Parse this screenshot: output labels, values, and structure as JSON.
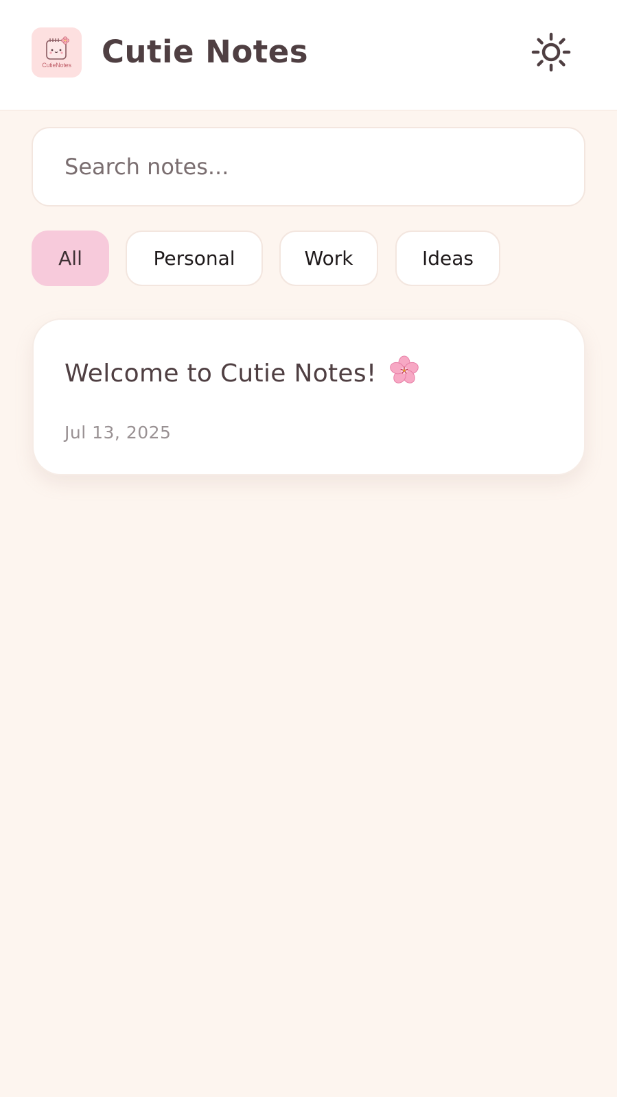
{
  "header": {
    "logo_text": "CutieNotes",
    "title": "Cutie Notes",
    "theme_icon": "sun-icon"
  },
  "search": {
    "placeholder": "Search notes...",
    "value": ""
  },
  "filters": [
    {
      "label": "All",
      "active": true
    },
    {
      "label": "Personal",
      "active": false
    },
    {
      "label": "Work",
      "active": false
    },
    {
      "label": "Ideas",
      "active": false
    }
  ],
  "notes": [
    {
      "title": "Welcome to Cutie Notes!",
      "title_icon": "cherry-blossom-icon",
      "date": "Jul 13, 2025"
    }
  ],
  "colors": {
    "background": "#fdf5ef",
    "surface": "#ffffff",
    "accent": "#f7cadb",
    "text": "#4f3f42",
    "muted": "#999193",
    "logo_bg": "#fde0e0"
  }
}
